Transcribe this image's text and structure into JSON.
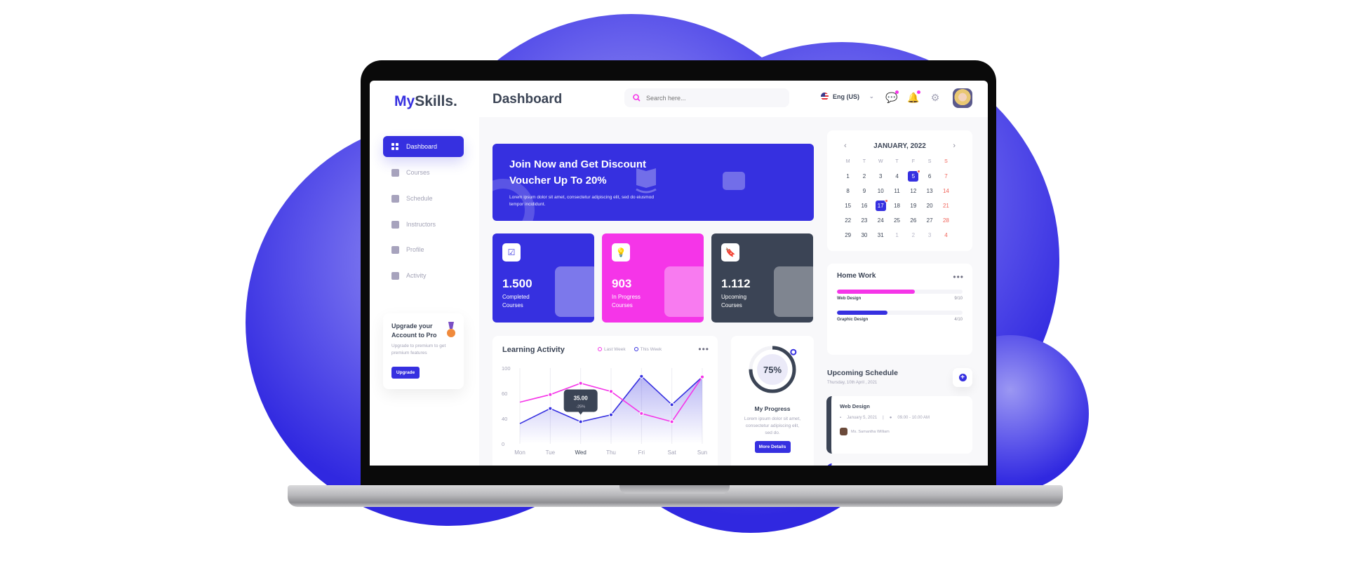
{
  "colors": {
    "primary": "#3630e0",
    "pink": "#f535e8",
    "dark": "#3b4455",
    "sunday": "#f0645a"
  },
  "header": {
    "logo_a": "My",
    "logo_b": "Skills.",
    "title": "Dashboard",
    "search_placeholder": "Search here...",
    "language": "Eng (US)",
    "icons": [
      "chat-icon",
      "bell-icon",
      "gear-icon"
    ]
  },
  "sidebar": {
    "items": [
      {
        "label": "Dashboard",
        "icon": "grid-icon",
        "active": true
      },
      {
        "label": "Courses",
        "icon": "book-icon"
      },
      {
        "label": "Schedule",
        "icon": "calendar-icon"
      },
      {
        "label": "Instructors",
        "icon": "users-icon"
      },
      {
        "label": "Profile",
        "icon": "user-icon"
      },
      {
        "label": "Activity",
        "icon": "activity-icon"
      }
    ],
    "upgrade": {
      "title": "Upgrade your Account to Pro",
      "text": "Upgrade to premium to get premium features",
      "button": "Upgrade"
    }
  },
  "banner": {
    "title": "Join Now and Get Discount Voucher Up To 20%",
    "text": "Lorem ipsum dolor sit amet, consectetur adipiscing elit, sed do eiusmod tempor incididunt."
  },
  "stats": [
    {
      "value": "1.500",
      "label": "Completed Courses",
      "color": "#3630e0",
      "icon": "checkbox-icon"
    },
    {
      "value": "903",
      "label": "In Progress Courses",
      "color": "#f535e8",
      "icon": "lightbulb-icon"
    },
    {
      "value": "1.112",
      "label": "Upcoming Courses",
      "color": "#3b4455",
      "icon": "bookmark-icon"
    }
  ],
  "learning": {
    "title": "Learning Activity",
    "legend": [
      "Last Week",
      "This Week"
    ]
  },
  "chart_data": {
    "type": "line",
    "categories": [
      "Mon",
      "Tue",
      "Wed",
      "Thu",
      "Fri",
      "Sat",
      "Sun"
    ],
    "yticks": [
      0,
      40,
      60,
      100
    ],
    "ylim": [
      0,
      100
    ],
    "grid": "vertical",
    "legend": "top-right",
    "series": [
      {
        "name": "Last Week",
        "color": "#f535e8",
        "values": [
          53,
          59,
          76,
          63,
          44,
          35,
          86
        ]
      },
      {
        "name": "This Week",
        "color": "#3630e0",
        "values": [
          32,
          48,
          35,
          43,
          87,
          51,
          86
        ],
        "area": true
      }
    ],
    "tooltip": {
      "category": "Wed",
      "value": "35.00",
      "change": "-25%"
    }
  },
  "progress": {
    "percent": 75,
    "label": "75%",
    "title": "My Progress",
    "text": "Lorem ipsum dolor sit amet, consectetur adipiscing elit, sed do.",
    "button": "More Details"
  },
  "calendar": {
    "title": "JANUARY, 2022",
    "weekdays": [
      "M",
      "T",
      "W",
      "T",
      "F",
      "S",
      "S"
    ],
    "days": [
      [
        "1",
        "2",
        "3",
        "4",
        "5",
        "6",
        "7"
      ],
      [
        "8",
        "9",
        "10",
        "11",
        "12",
        "13",
        "14"
      ],
      [
        "15",
        "16",
        "17",
        "18",
        "19",
        "20",
        "21"
      ],
      [
        "22",
        "23",
        "24",
        "25",
        "26",
        "27",
        "28"
      ],
      [
        "29",
        "30",
        "31",
        "1",
        "2",
        "3",
        "4"
      ]
    ],
    "selected": [
      "5",
      "17"
    ],
    "next_month_from_row4_col": 3
  },
  "homework": {
    "title": "Home Work",
    "items": [
      {
        "label": "Web Design",
        "score": "9/10",
        "progress": 0.62,
        "color": "#f535e8"
      },
      {
        "label": "Graphic Design",
        "score": "4/10",
        "progress": 0.4,
        "color": "#3630e0"
      }
    ]
  },
  "schedule": {
    "title": "Upcoming Schedule",
    "date": "Thursday, 10th April , 2021",
    "items": [
      {
        "title": "Web Design",
        "date": "January 5, 2021",
        "time": "09.00 - 10.00 AM",
        "person": "Ms. Samantha William"
      }
    ]
  }
}
